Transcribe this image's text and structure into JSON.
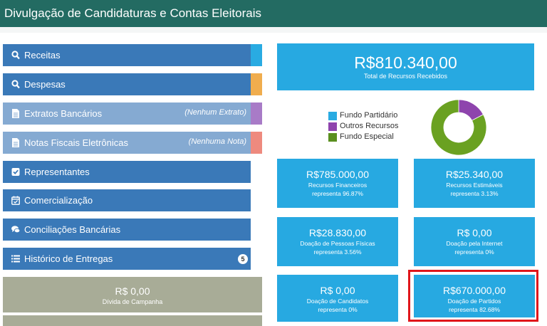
{
  "header": {
    "title": "Divulgação de Candidaturas e Contas Eleitorais"
  },
  "menu": [
    {
      "label": "Receitas",
      "icon": "search-icon",
      "edge_color": "#29abe2"
    },
    {
      "label": "Despesas",
      "icon": "search-icon",
      "edge_color": "#f0ad4e"
    },
    {
      "label": "Extratos Bancários",
      "icon": "document-icon",
      "note": "(Nenhum Extrato)",
      "edge_color": "#a87bc7"
    },
    {
      "label": "Notas Fiscais Eletrônicas",
      "icon": "document-icon",
      "note": "(Nenhuma Nota)",
      "edge_color": "#ee8a7e"
    },
    {
      "label": "Representantes",
      "icon": "checkbox-icon"
    },
    {
      "label": "Comercialização",
      "icon": "calendar-check-icon"
    },
    {
      "label": "Conciliações Bancárias",
      "icon": "comments-icon"
    },
    {
      "label": "Histórico de Entregas",
      "icon": "list-icon",
      "badge": "5"
    }
  ],
  "campaign_debt": {
    "value": "R$ 0,00",
    "label": "Dívida de Campanha"
  },
  "total_resources": {
    "value": "R$810.340,00",
    "label": "Total de Recursos Recebidos"
  },
  "legend": [
    {
      "label": "Fundo Partidário",
      "color": "#29abe2"
    },
    {
      "label": "Outros Recursos",
      "color": "#8e44ad"
    },
    {
      "label": "Fundo Especial",
      "color": "#5a8f1f"
    }
  ],
  "chart_data": {
    "type": "pie",
    "categories": [
      "Fundo Partidário",
      "Outros Recursos",
      "Fundo Especial"
    ],
    "values": [
      0,
      17.32,
      82.68
    ],
    "colors": [
      "#29abe2",
      "#8e44ad",
      "#6aa121"
    ]
  },
  "cards": [
    {
      "value": "R$785.000,00",
      "line1": "Recursos Financeiros",
      "line2": "representa 96.87%"
    },
    {
      "value": "R$25.340,00",
      "line1": "Recursos Estimáveis",
      "line2": "representa 3.13%"
    },
    {
      "value": "R$28.830,00",
      "line1": "Doação de Pessoas Físicas",
      "line2": "representa 3.56%"
    },
    {
      "value": "R$ 0,00",
      "line1": "Doação pela Internet",
      "line2": "representa 0%"
    },
    {
      "value": "R$ 0,00",
      "line1": "Doação de Candidatos",
      "line2": "representa 0%"
    },
    {
      "value": "R$670.000,00",
      "line1": "Doação de Partidos",
      "line2": "representa 82.68%"
    }
  ]
}
